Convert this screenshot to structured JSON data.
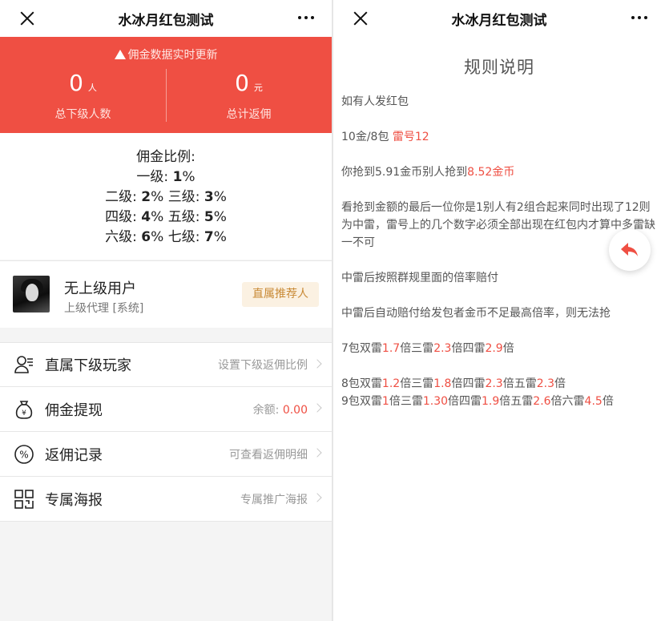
{
  "left": {
    "title": "水冰月红包测试",
    "notice": "佣金数据实时更新",
    "stats": [
      {
        "value": "0",
        "unit": "人",
        "label": "总下级人数"
      },
      {
        "value": "0",
        "unit": "元",
        "label": "总计返佣"
      }
    ],
    "rates": {
      "heading": "佣金比例:",
      "l1": {
        "label": "一级:",
        "value": "1",
        "pct": "%"
      },
      "l2": {
        "label": "二级:",
        "value": "2",
        "pct": "%"
      },
      "l3": {
        "label": "三级:",
        "value": "3",
        "pct": "%"
      },
      "l4": {
        "label": "四级:",
        "value": "4",
        "pct": "%"
      },
      "l5": {
        "label": "五级:",
        "value": "5",
        "pct": "%"
      },
      "l6": {
        "label": "六级:",
        "value": "6",
        "pct": "%"
      },
      "l7": {
        "label": "七级:",
        "value": "7",
        "pct": "%"
      }
    },
    "upline": {
      "name": "无上级用户",
      "sub": "上级代理 [系统]",
      "button": "直属推荐人"
    },
    "menu": [
      {
        "label": "直属下级玩家",
        "hint": "设置下级返佣比例",
        "icon": "users-icon"
      },
      {
        "label": "佣金提现",
        "hint_prefix": "余额: ",
        "hint_value": "0.00",
        "icon": "money-bag-icon"
      },
      {
        "label": "返佣记录",
        "hint": "可查看返佣明细",
        "icon": "percent-icon"
      },
      {
        "label": "专属海报",
        "hint": "专属推广海报",
        "icon": "qrcode-icon"
      }
    ]
  },
  "right": {
    "title": "水冰月红包测试",
    "heading": "规则说明",
    "p1": "如有人发红包",
    "p2a": "10金/8包 ",
    "p2b": "雷号12",
    "p3a": "你抢到5.91金币别人抢到",
    "p3b": "8.52金币",
    "p4": "看抢到金额的最后一位你是1别人有2组合起来同时出现了12则为中雷，雷号上的几个数字必须全部出现在红包内才算中多雷缺一不可",
    "p5": "中雷后按照群规里面的倍率赔付",
    "p6": "中雷后自动赔付给发包者金币不足最高倍率，则无法抢",
    "p7": [
      "7包双雷",
      "1.7",
      "倍三雷",
      "2.3",
      "倍四雷",
      "2.9",
      "倍"
    ],
    "p8": [
      "8包双雷",
      "1.2",
      "倍三雷",
      "1.8",
      "倍四雷",
      "2.3",
      "倍五雷",
      "2.3",
      "倍"
    ],
    "p9": [
      "9包双雷",
      "1",
      "倍三雷",
      "1.30",
      "倍四雷",
      "1.9",
      "倍五雷",
      "2.6",
      "倍六雷",
      "4.5",
      "倍"
    ]
  },
  "colors": {
    "accent": "#ef4f43",
    "gold": "#c98a36"
  }
}
